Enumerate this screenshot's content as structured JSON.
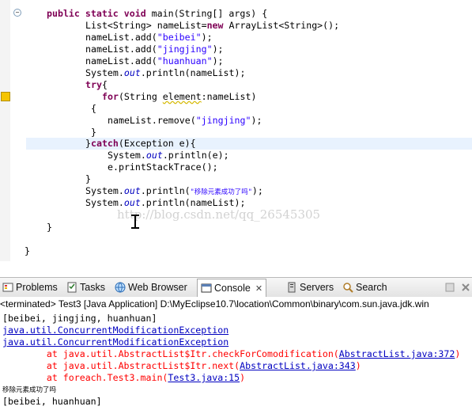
{
  "editor": {
    "lines": {
      "l1": {
        "kw1": "public",
        "kw2": "static",
        "kw3": "void",
        "rest": " main(String[] args) {"
      },
      "l2": {
        "a": "List<String> nameList=",
        "kw": "new",
        "b": " ArrayList<String>();"
      },
      "l3": {
        "a": "nameList.add(",
        "s": "\"beibei\"",
        "b": ");"
      },
      "l4": {
        "a": "nameList.add(",
        "s": "\"jingjing\"",
        "b": ");"
      },
      "l5": {
        "a": "nameList.add(",
        "s": "\"huanhuan\"",
        "b": ");"
      },
      "l6": {
        "a": "System.",
        "f": "out",
        "b": ".println(nameList);"
      },
      "l7": {
        "kw": "try",
        "b": "{"
      },
      "l8": {
        "kw": "for",
        "a": "(String ",
        "var": "element",
        "b": ":nameList)"
      },
      "l9": {
        "a": "{"
      },
      "l10": {
        "a": "nameList.remove(",
        "s": "\"jingjing\"",
        "b": ");"
      },
      "l11": {
        "a": "}"
      },
      "l12": {
        "a": "}",
        "kw": "catch",
        "b": "(Exception e){"
      },
      "l13": {
        "a": "System.",
        "f": "out",
        "b": ".println(e);"
      },
      "l14": {
        "a": "e.printStackTrace();"
      },
      "l15": {
        "a": "}"
      },
      "l16": {
        "a": "System.",
        "f": "out",
        "b": ".println(",
        "s": "\"移除元素成功了吗\"",
        "c": ");"
      },
      "l17": {
        "a": "System.",
        "f": "out",
        "b": ".println(nameList);"
      },
      "l18": {
        "a": "}"
      },
      "l19": {
        "a": "}"
      }
    },
    "watermark": "http://blog.csdn.net/qq_26545305"
  },
  "tabs": {
    "problems": "Problems",
    "tasks": "Tasks",
    "web_browser": "Web Browser",
    "console": "Console",
    "console_close": "✕",
    "servers": "Servers",
    "search": "Search"
  },
  "console": {
    "header": "<terminated> Test3 [Java Application] D:\\MyEclipse10.7\\location\\Common\\binary\\com.sun.java.jdk.win",
    "line1": "[beibei, jingjing, huanhuan]",
    "line2": "java.util.ConcurrentModificationException",
    "line3": "java.util.ConcurrentModificationException",
    "line4": {
      "pre": "        at java.util.AbstractList$Itr.checkForComodification(",
      "link": "AbstractList.java:372",
      "post": ")"
    },
    "line5": {
      "pre": "        at java.util.AbstractList$Itr.next(",
      "link": "AbstractList.java:343",
      "post": ")"
    },
    "line6": {
      "pre": "        at foreach.Test3.main(",
      "link": "Test3.java:15",
      "post": ")"
    },
    "line7": "移除元素成功了吗",
    "line8": "[beibei, huanhuan]"
  },
  "colors": {
    "keyword": "#7f0055",
    "string": "#2a00ff",
    "field": "#0000c0",
    "error": "#ff0000",
    "link": "#0000c0"
  }
}
